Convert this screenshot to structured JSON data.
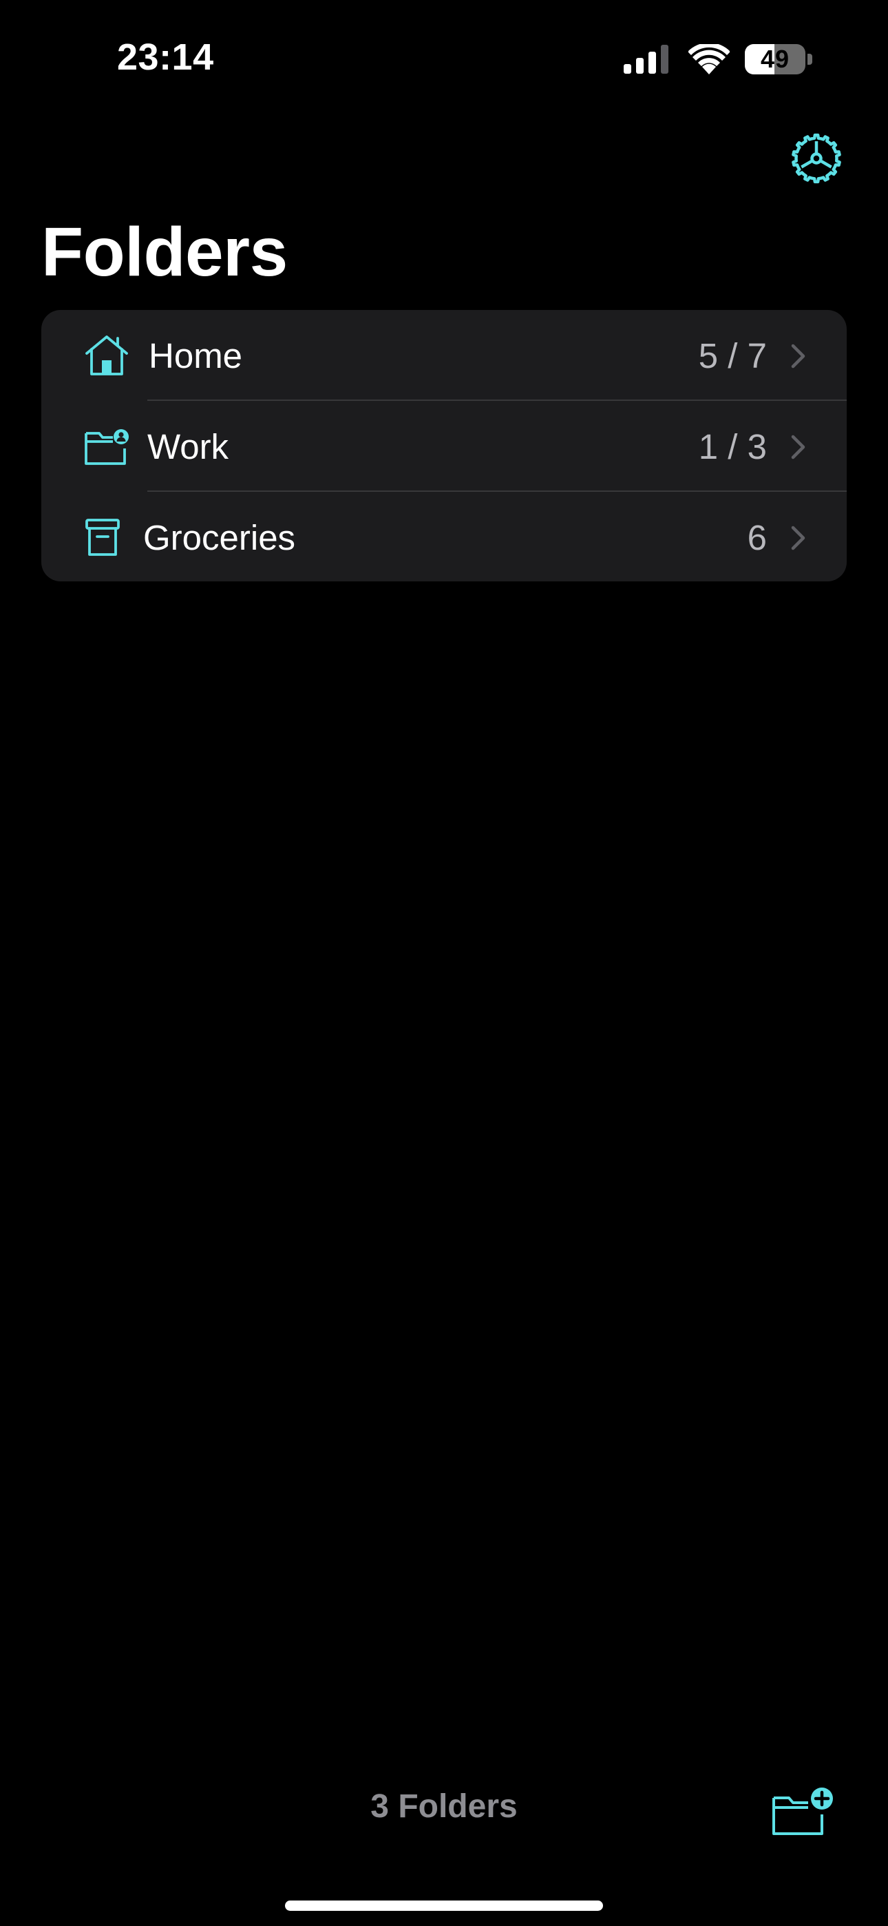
{
  "status_bar": {
    "time": "23:14",
    "battery": "49",
    "battery_level": 0.49
  },
  "header": {
    "title": "Folders",
    "settings_icon": "gear-icon"
  },
  "folders": [
    {
      "label": "Home",
      "count": "5 / 7",
      "icon": "house-icon"
    },
    {
      "label": "Work",
      "count": "1 / 3",
      "icon": "folder-person-icon"
    },
    {
      "label": "Groceries",
      "count": "6",
      "icon": "archive-box-icon"
    }
  ],
  "toolbar": {
    "folder_count": "3 Folders",
    "new_folder_icon": "folder-add-icon"
  },
  "colors": {
    "accent": "#5de0e6",
    "background": "#000000",
    "card": "#1c1c1e",
    "separator": "#38383a",
    "secondary_text": "#8e8e93"
  }
}
